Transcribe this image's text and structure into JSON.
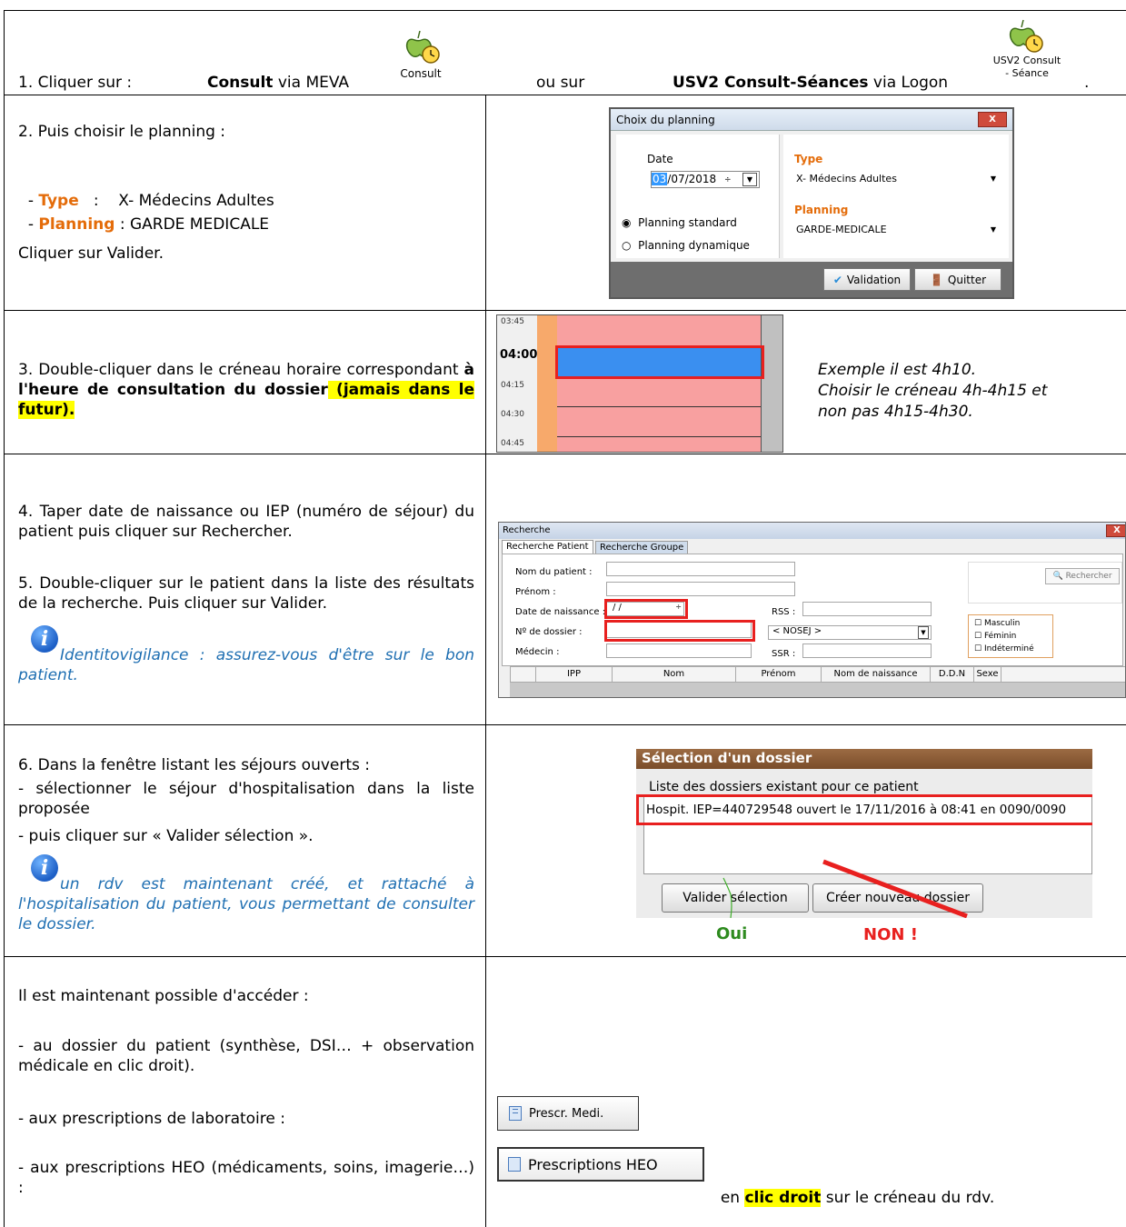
{
  "row1": {
    "step": "1. Cliquer sur :",
    "consult_bold": "Consult",
    "via_meva": " via MEVA",
    "consult_icon_label": "Consult",
    "ou_sur": "ou sur",
    "usv2_bold": "USV2 Consult-Séances",
    "via_logon": " via Logon",
    "usv2_icon_label_1": "USV2 Consult",
    "usv2_icon_label_2": "- Séance",
    "dot": "."
  },
  "row2": {
    "line1": "2. Puis choisir le planning :",
    "type_prefix": "- ",
    "type_label": "Type",
    "type_value": "   :    X- Médecins Adultes",
    "planning_prefix": "- ",
    "planning_label": "Planning",
    "planning_value": " : GARDE MEDICALE",
    "line4": "Cliquer sur Valider.",
    "dialog": {
      "title": "Choix du planning",
      "date_label": "Date",
      "date_day": "03",
      "date_rest": "/07/2018",
      "radio_standard": "Planning standard",
      "radio_dynamic": "Planning dynamique",
      "type_label": "Type",
      "type_value": "X- Médecins Adultes",
      "planning_label": "Planning",
      "planning_value": "GARDE-MEDICALE",
      "btn_validation": "Validation",
      "btn_quitter": "Quitter",
      "close": "X"
    }
  },
  "row3": {
    "text1": "3. Double-cliquer dans le créneau horaire correspondant ",
    "text_bold": "à l'heure de consultation du dossier",
    "text_hl": " (jamais dans le futur).",
    "times": [
      "03:45",
      "04:00",
      "04:15",
      "04:30",
      "04:45"
    ],
    "example": [
      "Exemple il est 4h10.",
      "Choisir le créneau 4h-4h15 et",
      "non pas 4h15-4h30."
    ]
  },
  "row4": {
    "step4": "4. Taper date de naissance ou IEP (numéro de séjour) du patient puis cliquer sur Rechercher.",
    "step5": "5. Double-cliquer sur le patient dans la liste des résultats de la recherche. Puis cliquer sur Valider.",
    "note": "Identitovigilance : assurez-vous d'être sur le bon patient.",
    "search": {
      "title": "Recherche",
      "tab1": "Recherche Patient",
      "tab2": "Recherche Groupe",
      "nom": "Nom du patient :",
      "prenom": "Prénom :",
      "ddn": "Date de naissance :",
      "ddn_value": "/ /",
      "dossier": "Nº de dossier :",
      "medecin": "Médecin :",
      "rss": "RSS :",
      "ssr": "SSR :",
      "nosej": "< NOSEJ >",
      "rechercher": "Rechercher",
      "masculin": "Masculin",
      "feminin": "Féminin",
      "indetermine": "Indéterminé",
      "columns": [
        "IPP",
        "Nom",
        "Prénom",
        "Nom de naissance",
        "D.D.N",
        "Sexe"
      ],
      "close": "X"
    }
  },
  "row5": {
    "intro": "6. Dans la fenêtre listant les séjours ouverts :",
    "line1": "- sélectionner le séjour d'hospitalisation dans la liste proposée",
    "line2": "- puis cliquer sur « Valider sélection ».",
    "note": "un rdv est maintenant créé, et rattaché à l'hospitalisation du patient, vous permettant de consulter le dossier.",
    "dialog": {
      "title": "Sélection d'un dossier",
      "subtitle": "Liste des dossiers existant pour ce patient",
      "item": "Hospit. IEP=440729548 ouvert le 17/11/2016 à 08:41 en 0090/0090",
      "btn_valider": "Valider sélection",
      "btn_creer": "Créer nouveau dossier",
      "oui": "Oui",
      "non": "NON !"
    },
    "colors": {
      "oui": "#2e8b1f",
      "non": "#e8201f"
    }
  },
  "row6": {
    "intro": "Il est maintenant possible d'accéder :",
    "line1": "- au dossier du patient (synthèse, DSI… + observation médicale en clic droit).",
    "line2": "- aux prescriptions de laboratoire :",
    "line3": "- aux prescriptions HEO (médicaments, soins, imagerie…) :",
    "btn_presc": "Prescr. Medi.",
    "btn_heo": "Prescriptions HEO",
    "en": "en ",
    "clic_droit": "clic droit",
    "suffix": " sur le créneau du rdv."
  }
}
